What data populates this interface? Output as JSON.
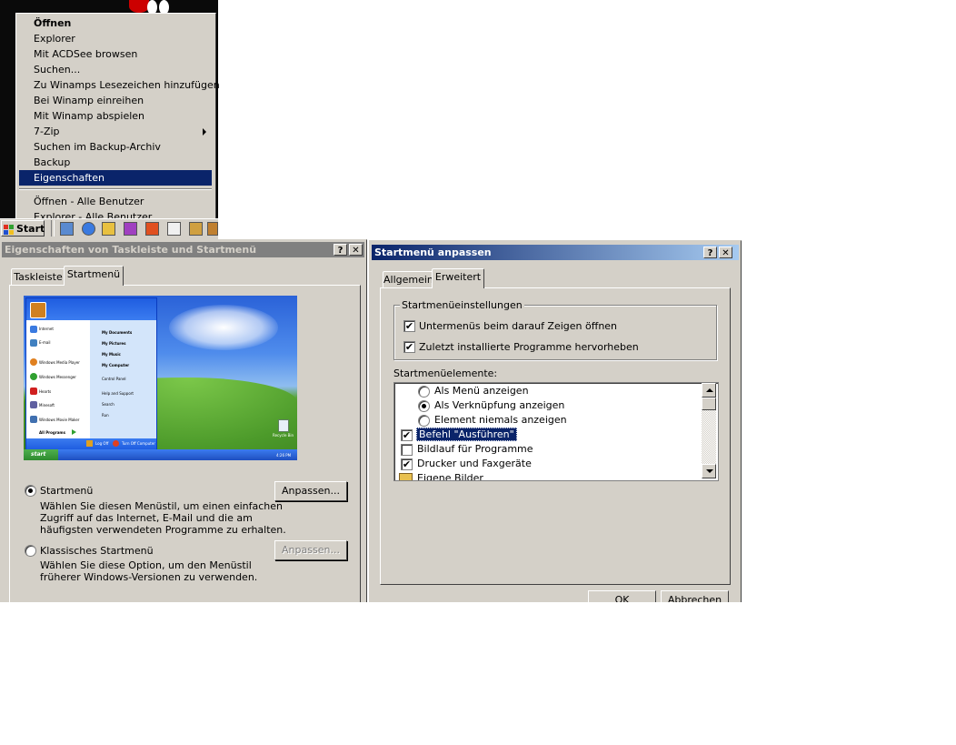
{
  "context_menu": {
    "items": [
      {
        "label": "Öffnen"
      },
      {
        "label": "Explorer"
      },
      {
        "label": "Mit ACDSee browsen"
      },
      {
        "label": "Suchen..."
      },
      {
        "label": "Zu Winamps Lesezeichen hinzufügen"
      },
      {
        "label": "Bei Winamp einreihen"
      },
      {
        "label": "Mit Winamp abspielen"
      },
      {
        "label": "7-Zip"
      },
      {
        "label": "Suchen im Backup-Archiv"
      },
      {
        "label": "Backup"
      },
      {
        "label": "Eigenschaften"
      },
      {
        "label": "Öffnen - Alle Benutzer"
      },
      {
        "label": "Explorer - Alle Benutzer"
      }
    ]
  },
  "taskbar": {
    "start_label": "Start"
  },
  "window_taskbar_props": {
    "title": "Eigenschaften von Taskleiste und Startmenü",
    "help_btn": "?",
    "close_btn": "✕",
    "tabs": [
      {
        "label": "Taskleiste"
      },
      {
        "label": "Startmenü"
      }
    ],
    "preview": {
      "left_items": [
        "Internet",
        "E-mail",
        "Windows Media Player",
        "Windows Messenger",
        "Hearts",
        "Minesoft",
        "Windows Movie Maker"
      ],
      "right_items": [
        "My Documents",
        "My Pictures",
        "My Music",
        "My Computer",
        "Control Panel",
        "Help and Support",
        "Search",
        "Run"
      ],
      "all_programs": "All Programs",
      "log_off": "Log Off",
      "turn_off": "Turn Off Computer",
      "start": "start",
      "recycle": "Recycle Bin",
      "clock": "4:26 PM"
    },
    "option_startmenu": {
      "label": "Startmenü",
      "desc1": "Wählen Sie diesen Menüstil, um einen einfachen",
      "desc2": "Zugriff auf das Internet, E-Mail und die am",
      "desc3": "häufigsten verwendeten Programme zu erhalten.",
      "button": "Anpassen..."
    },
    "option_classic": {
      "label": "Klassisches Startmenü",
      "desc1": "Wählen Sie diese Option, um den Menüstil",
      "desc2": "früherer Windows-Versionen zu verwenden.",
      "button": "Anpassen..."
    }
  },
  "window_customize": {
    "title": "Startmenü anpassen",
    "help_btn": "?",
    "close_btn": "✕",
    "tabs": [
      {
        "label": "Allgemein"
      },
      {
        "label": "Erweitert"
      }
    ],
    "settings_group": "Startmenüeinstellungen",
    "settings": [
      {
        "label": "Untermenüs beim darauf Zeigen öffnen",
        "checked": "✔"
      },
      {
        "label": "Zuletzt installierte Programme hervorheben",
        "checked": "✔"
      }
    ],
    "elements_label": "Startmenüelemente:",
    "list": {
      "radio1": "Als Menü anzeigen",
      "radio2": "Als Verknüpfung anzeigen",
      "radio3": "Element niemals anzeigen",
      "item1": "Befehl \"Ausführen\"",
      "item2": "Bildlauf für Programme",
      "item3": "Drucker und Faxgeräte",
      "item4": "Eigene Bilder",
      "check_mark": "✔"
    },
    "ok": "OK",
    "cancel": "Abbrechen"
  }
}
